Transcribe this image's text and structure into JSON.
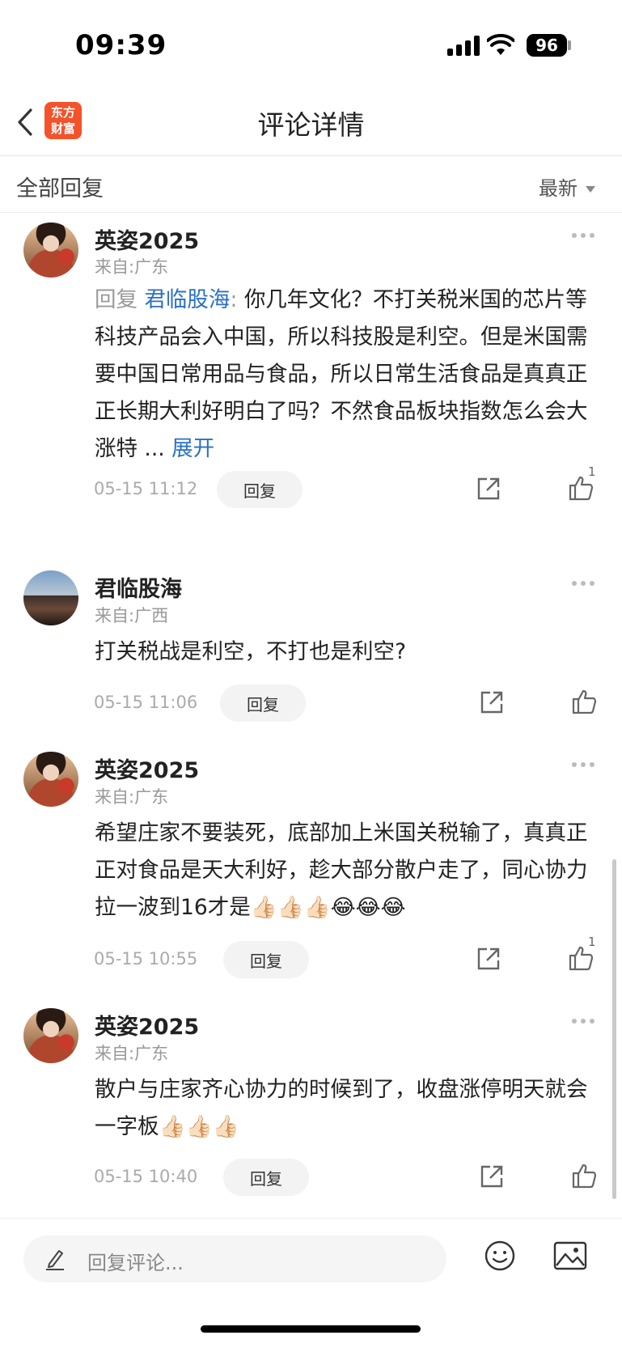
{
  "status_bar": {
    "time": "09:39",
    "battery": "96"
  },
  "header": {
    "back_icon": "chevron-left-icon",
    "logo_line1": "东方",
    "logo_line2": "财富",
    "title": "评论详情"
  },
  "filter": {
    "label": "全部回复",
    "sort": "最新"
  },
  "comments": [
    {
      "username": "英姿2025",
      "location": "来自:广东",
      "reply_prefix": "回复",
      "reply_to": "君临股海",
      "separator": ":",
      "text": "你几年文化？不打关税米国的芯片等科技产品会入中国，所以科技股是利空。但是米国需要中国日常用品与食品，所以日常生活食品是真真正正长期大利好明白了吗？不然食品板块指数怎么会大涨特 ...",
      "expand": "展开",
      "time": "05-15 11:12",
      "reply_button": "回复",
      "likes": "1"
    },
    {
      "username": "君临股海",
      "location": "来自:广西",
      "text": "打关税战是利空，不打也是利空?",
      "time": "05-15 11:06",
      "reply_button": "回复"
    },
    {
      "username": "英姿2025",
      "location": "来自:广东",
      "text": "希望庄家不要装死，底部加上米国关税输了，真真正正对食品是天大利好，趁大部分散户走了，同心协力拉一波到16才是👍🏻👍🏻👍🏻😂😂😂",
      "time": "05-15 10:55",
      "reply_button": "回复",
      "likes": "1"
    },
    {
      "username": "英姿2025",
      "location": "来自:广东",
      "text": "散户与庄家齐心协力的时候到了，收盘涨停明天就会一字板👍🏻👍🏻👍🏻",
      "time": "05-15 10:40",
      "reply_button": "回复"
    }
  ],
  "bottom_bar": {
    "placeholder": "回复评论..."
  },
  "colors": {
    "accent": "#2a6fc9",
    "brand": "#f3522b"
  }
}
